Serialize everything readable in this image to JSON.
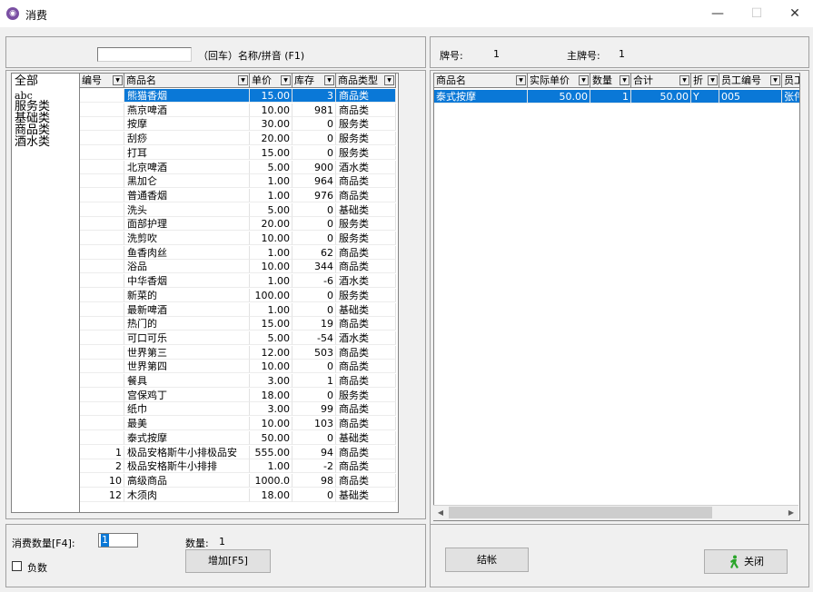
{
  "window": {
    "title": "消费",
    "icon": "app-logo-icon",
    "minimize_glyph": "—",
    "maximize_glyph": "☐",
    "close_glyph": "✕"
  },
  "search": {
    "value": "",
    "hint": "（回车）名称/拼音  (F1)"
  },
  "categories": [
    "全部",
    "abc",
    "服务类",
    "基础类",
    "商品类",
    "酒水类"
  ],
  "product_grid": {
    "columns": [
      {
        "label": "编号"
      },
      {
        "label": "商品名"
      },
      {
        "label": "单价"
      },
      {
        "label": "库存"
      },
      {
        "label": "商品类型"
      }
    ],
    "rows": [
      {
        "id": "",
        "name": "熊猫香烟",
        "price": "15.00",
        "stock": "3",
        "type": "商品类"
      },
      {
        "id": "",
        "name": "燕京啤酒",
        "price": "10.00",
        "stock": "981",
        "type": "商品类"
      },
      {
        "id": "",
        "name": "按摩",
        "price": "30.00",
        "stock": "0",
        "type": "服务类"
      },
      {
        "id": "",
        "name": "刮痧",
        "price": "20.00",
        "stock": "0",
        "type": "服务类"
      },
      {
        "id": "",
        "name": "打耳",
        "price": "15.00",
        "stock": "0",
        "type": "服务类"
      },
      {
        "id": "",
        "name": "北京啤酒",
        "price": "5.00",
        "stock": "900",
        "type": "酒水类"
      },
      {
        "id": "",
        "name": "黑加仑",
        "price": "1.00",
        "stock": "964",
        "type": "商品类"
      },
      {
        "id": "",
        "name": "普通香烟",
        "price": "1.00",
        "stock": "976",
        "type": "商品类"
      },
      {
        "id": "",
        "name": "洗头",
        "price": "5.00",
        "stock": "0",
        "type": "基础类"
      },
      {
        "id": "",
        "name": "面部护理",
        "price": "20.00",
        "stock": "0",
        "type": "服务类"
      },
      {
        "id": "",
        "name": "洗剪吹",
        "price": "10.00",
        "stock": "0",
        "type": "服务类"
      },
      {
        "id": "",
        "name": "鱼香肉丝",
        "price": "1.00",
        "stock": "62",
        "type": "商品类"
      },
      {
        "id": "",
        "name": "浴品",
        "price": "10.00",
        "stock": "344",
        "type": "商品类"
      },
      {
        "id": "",
        "name": "中华香烟",
        "price": "1.00",
        "stock": "-6",
        "type": "酒水类"
      },
      {
        "id": "",
        "name": "新菜的",
        "price": "100.00",
        "stock": "0",
        "type": "服务类"
      },
      {
        "id": "",
        "name": "最新啤酒",
        "price": "1.00",
        "stock": "0",
        "type": "基础类"
      },
      {
        "id": "",
        "name": "热门的",
        "price": "15.00",
        "stock": "19",
        "type": "商品类"
      },
      {
        "id": "",
        "name": "可口可乐",
        "price": "5.00",
        "stock": "-54",
        "type": "酒水类"
      },
      {
        "id": "",
        "name": "世界第三",
        "price": "12.00",
        "stock": "503",
        "type": "商品类"
      },
      {
        "id": "",
        "name": "世界第四",
        "price": "10.00",
        "stock": "0",
        "type": "商品类"
      },
      {
        "id": "",
        "name": "餐具",
        "price": "3.00",
        "stock": "1",
        "type": "商品类"
      },
      {
        "id": "",
        "name": "宫保鸡丁",
        "price": "18.00",
        "stock": "0",
        "type": "服务类"
      },
      {
        "id": "",
        "name": "纸巾",
        "price": "3.00",
        "stock": "99",
        "type": "商品类"
      },
      {
        "id": "",
        "name": "最美",
        "price": "10.00",
        "stock": "103",
        "type": "商品类"
      },
      {
        "id": "",
        "name": "泰式按摩",
        "price": "50.00",
        "stock": "0",
        "type": "基础类"
      },
      {
        "id": "1",
        "name": "极品安格斯牛小排极品安",
        "price": "555.00",
        "stock": "94",
        "type": "商品类"
      },
      {
        "id": "2",
        "name": "极品安格斯牛小排排",
        "price": "1.00",
        "stock": "-2",
        "type": "商品类"
      },
      {
        "id": "10",
        "name": "高级商品",
        "price": "1000.0",
        "stock": "98",
        "type": "商品类"
      },
      {
        "id": "12",
        "name": "木须肉",
        "price": "18.00",
        "stock": "0",
        "type": "基础类"
      }
    ],
    "selected_index": 0
  },
  "info": {
    "card_label": "牌号:",
    "card_value": "1",
    "main_card_label": "主牌号:",
    "main_card_value": "1"
  },
  "order_grid": {
    "columns": [
      {
        "label": "商品名"
      },
      {
        "label": "实际单价"
      },
      {
        "label": "数量"
      },
      {
        "label": "合计"
      },
      {
        "label": "折"
      },
      {
        "label": "员工编号"
      },
      {
        "label": "员工"
      }
    ],
    "rows": [
      {
        "name": "泰式按摩",
        "price": "50.00",
        "qty": "1",
        "total": "50.00",
        "discount": "Y",
        "emp_id": "005",
        "emp": "张伟"
      }
    ]
  },
  "bottom_left": {
    "qty_label": "消费数量[F4]:",
    "qty_value": "1",
    "count_label": "数量:",
    "count_value": "1",
    "negative_label": "负数",
    "negative_checked": false,
    "add_button": "增加[F5]"
  },
  "bottom_right": {
    "checkout_button": "结帐",
    "close_button": "关闭",
    "close_icon": "person-walking-icon"
  },
  "colors": {
    "selection": "#0a78d7",
    "window_bg": "#f0f0f0",
    "close_icon": "#2aa52a"
  }
}
